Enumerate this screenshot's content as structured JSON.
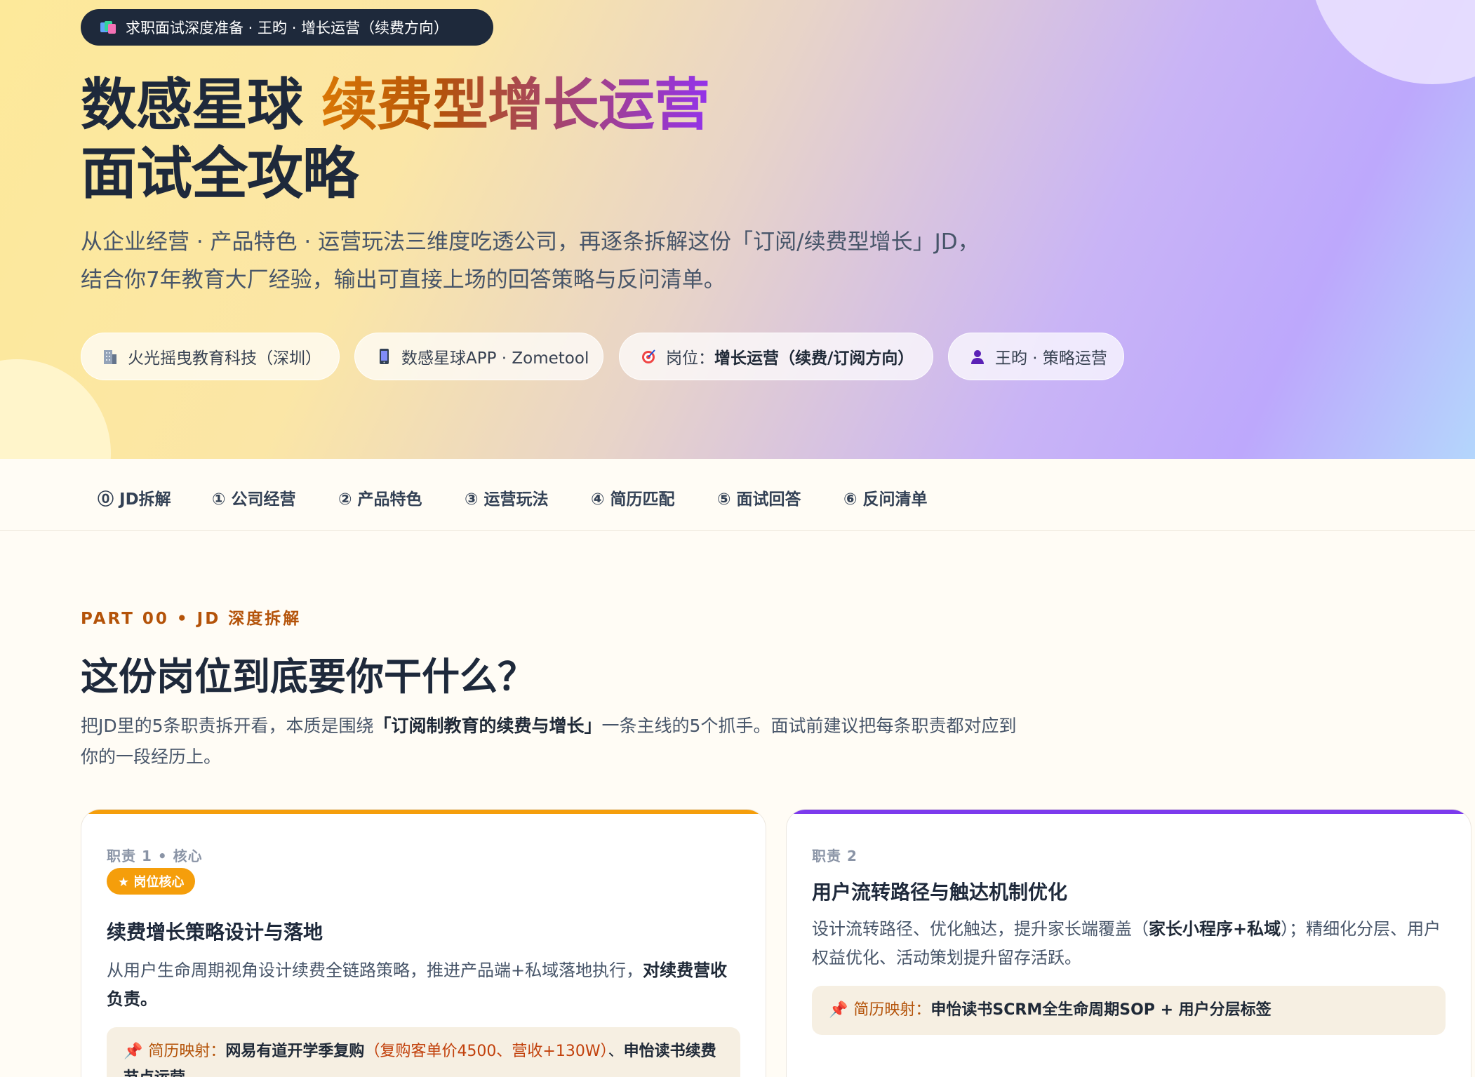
{
  "hero": {
    "tag": "求职面试深度准备 · 王昀 · 增长运营（续费方向）",
    "title_part1": "数感星球 ",
    "title_highlight": "续费型增长运营",
    "title_line2": "面试全攻略",
    "subtitle_line1": "从企业经营 · 产品特色 · 运营玩法三维度吃透公司，再逐条拆解这份「订阅/续费型增长」JD，",
    "subtitle_line2": "结合你7年教育大厂经验，输出可直接上场的回答策略与反问清单。",
    "chips": [
      {
        "icon": "building-icon",
        "text": "火光摇曳教育科技（深圳）"
      },
      {
        "icon": "phone-icon",
        "text": "数感星球APP · Zometool"
      },
      {
        "icon": "target-icon",
        "prefix": "岗位：",
        "bold": "增长运营（续费/订阅方向）"
      },
      {
        "icon": "person-icon",
        "text": "王昀 · 策略运营"
      }
    ]
  },
  "nav": {
    "items": [
      "⓪ JD拆解",
      "① 公司经营",
      "② 产品特色",
      "③ 运营玩法",
      "④ 简历匹配",
      "⑤ 面试回答",
      "⑥ 反问清单"
    ]
  },
  "section": {
    "eyebrow": "PART 00 • JD 深度拆解",
    "title": "这份岗位到底要你干什么？",
    "lead_1": "把JD里的5条职责拆开看，本质是围绕",
    "lead_bold": "「订阅制教育的续费与增长」",
    "lead_2": "一条主线的5个抓手。面试前建议把每条职责都对应到",
    "lead_3": "你的一段经历上。"
  },
  "cards": [
    {
      "label": "职责 1 • 核心",
      "badge": "★ 岗位核心",
      "title": "续费增长策略设计与落地",
      "desc_1": "从用户生命周期视角设计续费全链路策略，推进产品端+私域落地执行，",
      "desc_bold": "对续费营收负责。",
      "map_key": "简历映射：",
      "map_bold_1": "网易有道开学季复购",
      "map_hi": "（复购客单价4500、营收+130W）",
      "map_sep": "、",
      "map_bold_2": "申怡读书续费节点运营",
      "accent": "#f59e0b"
    },
    {
      "label": "职责 2",
      "title": "用户流转路径与触达机制优化",
      "desc_1": "设计流转路径、优化触达，提升家长端覆盖（",
      "desc_bold": "家长小程序+私域",
      "desc_2": "）；精细化分层、用户权益优化、活动策划提升留存活跃。",
      "map_key": "简历映射：",
      "map_bold_1": "申怡读书SCRM全生命周期SOP + 用户分层标签",
      "accent": "#7c3aed"
    }
  ],
  "colors": {
    "dark": "#1e293b",
    "amber": "#b45309",
    "purple": "#7c3aed",
    "orange": "#f59e0b"
  }
}
